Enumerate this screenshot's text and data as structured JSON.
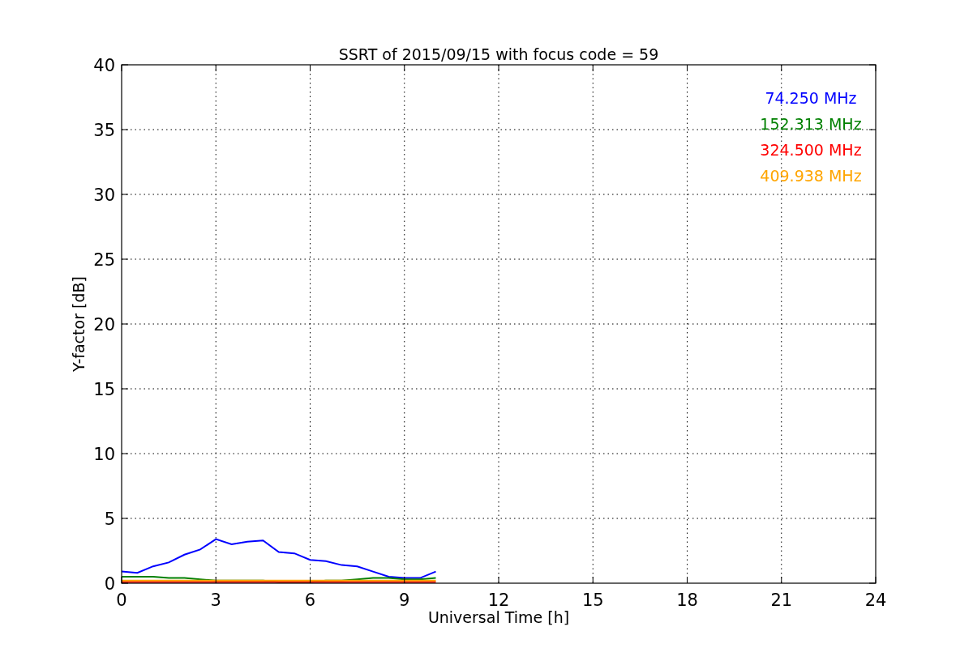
{
  "chart_data": {
    "type": "line",
    "title": "SSRT of 2015/09/15 with focus code = 59",
    "xlabel": "Universal Time [h]",
    "ylabel": "Y-factor [dB]",
    "x": [
      0,
      0.5,
      1,
      1.5,
      2,
      2.5,
      3,
      3.5,
      4,
      4.5,
      5,
      5.5,
      6,
      6.5,
      7,
      7.5,
      8,
      8.5,
      9,
      9.5,
      10
    ],
    "series": [
      {
        "name": "74.250 MHz",
        "color": "#0000ff",
        "values": [
          0.9,
          0.8,
          1.3,
          1.6,
          2.2,
          2.6,
          3.4,
          3.0,
          3.2,
          3.3,
          2.4,
          2.3,
          1.8,
          1.7,
          1.4,
          1.3,
          0.9,
          0.5,
          0.4,
          0.4,
          0.9
        ]
      },
      {
        "name": "152.313 MHz",
        "color": "#008000",
        "values": [
          0.5,
          0.5,
          0.5,
          0.4,
          0.4,
          0.3,
          0.2,
          0.2,
          0.2,
          0.2,
          0.1,
          0.1,
          0.1,
          0.2,
          0.2,
          0.3,
          0.4,
          0.4,
          0.3,
          0.3,
          0.4
        ]
      },
      {
        "name": "324.500 MHz",
        "color": "#ff0000",
        "values": [
          0.1,
          0.1,
          0.1,
          0.1,
          0.1,
          0.1,
          0.1,
          0.1,
          0.1,
          0.1,
          0.1,
          0.1,
          0.1,
          0.1,
          0.1,
          0.1,
          0.1,
          0.1,
          0.1,
          0.1,
          0.1
        ]
      },
      {
        "name": "409.938 MHz",
        "color": "#ffa500",
        "values": [
          0.2,
          0.2,
          0.2,
          0.2,
          0.2,
          0.2,
          0.2,
          0.2,
          0.2,
          0.2,
          0.2,
          0.2,
          0.2,
          0.2,
          0.2,
          0.2,
          0.2,
          0.2,
          0.2,
          0.2,
          0.2
        ]
      }
    ],
    "grid": true,
    "xlim": [
      0,
      24
    ],
    "ylim": [
      0,
      40
    ],
    "xticks": [
      0,
      3,
      6,
      9,
      12,
      15,
      18,
      21,
      24
    ],
    "yticks": [
      0,
      5,
      10,
      15,
      20,
      25,
      30,
      35,
      40
    ]
  }
}
